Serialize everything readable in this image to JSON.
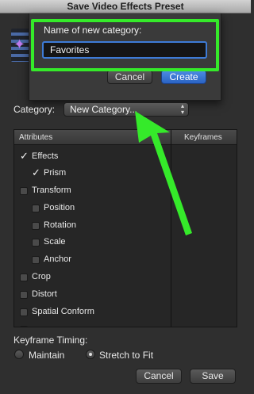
{
  "window": {
    "title": "Save Video Effects Preset"
  },
  "sheet": {
    "prompt": "Name of new category:",
    "input_value": "Favorites",
    "cancel_label": "Cancel",
    "create_label": "Create"
  },
  "category": {
    "label": "Category:",
    "selected": "New Category..."
  },
  "table": {
    "headers": {
      "attributes": "Attributes",
      "keyframes": "Keyframes"
    },
    "rows": [
      {
        "label": "Effects",
        "checked": true
      },
      {
        "label": "Prism",
        "checked": true
      },
      {
        "label": "Transform",
        "checked": false
      },
      {
        "label": "Position",
        "checked": false
      },
      {
        "label": "Rotation",
        "checked": false
      },
      {
        "label": "Scale",
        "checked": false
      },
      {
        "label": "Anchor",
        "checked": false
      },
      {
        "label": "Crop",
        "checked": false
      },
      {
        "label": "Distort",
        "checked": false
      },
      {
        "label": "Spatial Conform",
        "checked": false
      }
    ]
  },
  "keyframe_timing": {
    "label": "Keyframe Timing:",
    "options": [
      "Maintain",
      "Stretch to Fit"
    ],
    "selected": "Stretch to Fit"
  },
  "footer": {
    "cancel_label": "Cancel",
    "save_label": "Save"
  },
  "colors": {
    "highlight": "#35ea2a",
    "accent": "#3e7bd6",
    "arrow": "#35ea2a"
  },
  "icons": {
    "app": "video-effects-icon",
    "check": "checkmark-icon",
    "popup": "updown-chevron-icon"
  }
}
